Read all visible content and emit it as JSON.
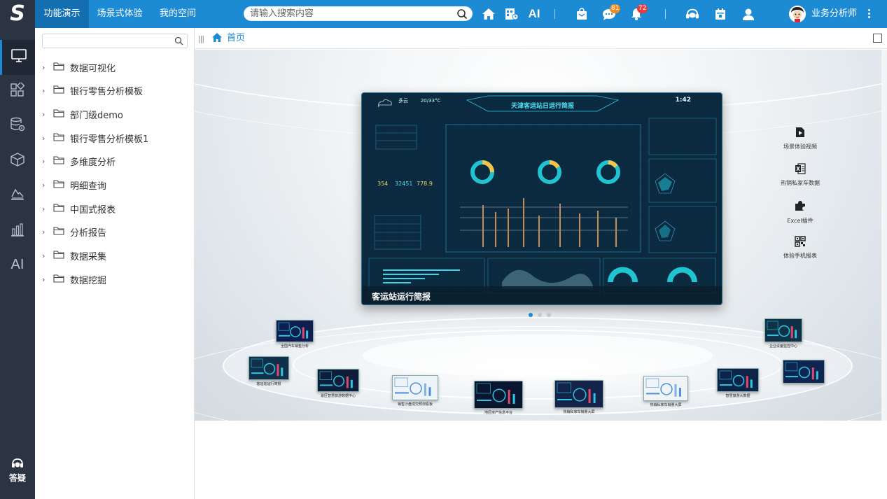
{
  "topbar": {
    "tabs": [
      {
        "label": "功能演示",
        "active": true
      },
      {
        "label": "场景式体验",
        "active": false
      },
      {
        "label": "我的空间",
        "active": false
      }
    ],
    "search_placeholder": "请输入搜索内容",
    "ai_label": "AI",
    "message_count": "81",
    "notification_count": "72",
    "username": "业务分析师",
    "icons": [
      "home-icon",
      "report-grid-icon",
      "ai-icon",
      "mail-bag-icon",
      "chat-icon",
      "bell-icon",
      "headset-icon",
      "calendar-icon",
      "user-icon"
    ],
    "colors": {
      "bar": "#1d8ad4",
      "active_tab": "#146fb0",
      "badge_orange": "#f08a1e",
      "badge_red": "#e83a3a"
    }
  },
  "rail": {
    "items": [
      "monitor-icon",
      "apps-grid-icon",
      "database-gear-icon",
      "cube-icon",
      "layers-chart-icon",
      "bar-chart-icon"
    ],
    "ai_label": "AI",
    "help_label": "答疑"
  },
  "tree": {
    "search_placeholder": "",
    "items": [
      {
        "label": "数据可视化"
      },
      {
        "label": "银行零售分析模板"
      },
      {
        "label": "部门级demo"
      },
      {
        "label": "银行零售分析模板1"
      },
      {
        "label": "多维度分析"
      },
      {
        "label": "明细查询"
      },
      {
        "label": "中国式报表"
      },
      {
        "label": "分析报告"
      },
      {
        "label": "数据采集"
      },
      {
        "label": "数据挖掘"
      }
    ]
  },
  "breadcrumb": {
    "label": "首页"
  },
  "showcase": {
    "dashboard": {
      "title": "天津客运站日运行简报",
      "weather": "多云",
      "temperature": "20/33°C",
      "time": "1:42",
      "kpis": [
        "354",
        "32451",
        "778.9"
      ],
      "caption": "客运站运行简报"
    },
    "carousel_pages": 3,
    "carousel_active": 1,
    "quick_links": [
      {
        "icon": "video-icon",
        "label": "场景体验视频"
      },
      {
        "icon": "excel-icon",
        "label": "热销私家车数据"
      },
      {
        "icon": "puzzle-icon",
        "label": "Excel插件"
      },
      {
        "icon": "qrcode-icon",
        "label": "体验手机报表"
      }
    ],
    "thumbnails": [
      {
        "label": "全国汽车销售分析"
      },
      {
        "label": "客运站运行简报"
      },
      {
        "label": "景区智慧旅游数据中心"
      },
      {
        "label": "销售沙盘成交预测看板"
      },
      {
        "label": "地区房产信息平台"
      },
      {
        "label": "热销私家车销量大屏"
      },
      {
        "label": "热销私家车销量大屏"
      },
      {
        "label": "智慧旅游大数据"
      },
      {
        "label": "企业设备监控中心"
      },
      {
        "label": ""
      }
    ]
  }
}
